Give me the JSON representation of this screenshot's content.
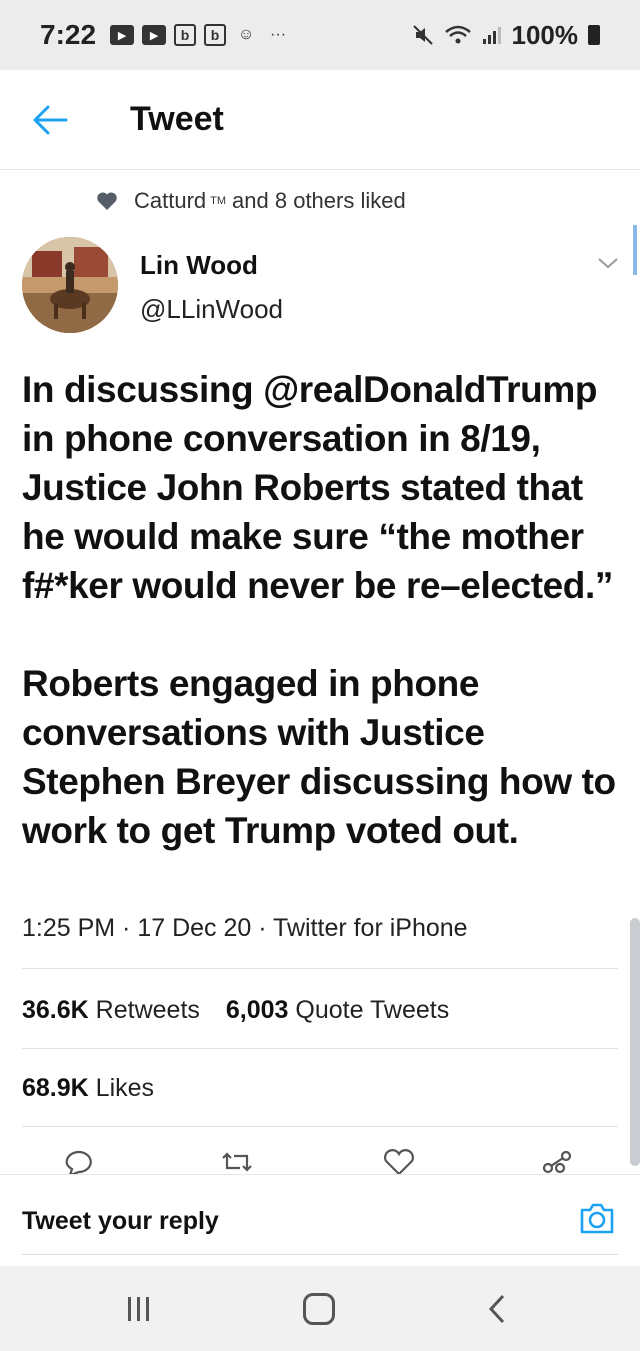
{
  "status_bar": {
    "time": "7:22",
    "icons": [
      "youtube-icon",
      "youtube-icon",
      "b-app-icon",
      "b-app-icon",
      "assistant-icon",
      "more-dots-icon"
    ],
    "icon_glyphs": [
      "▶",
      "▶",
      "b",
      "b",
      "☺",
      "···"
    ],
    "battery": "100%"
  },
  "header": {
    "title": "Tweet"
  },
  "social_context": {
    "name": "Catturd",
    "trademark": "TM",
    "suffix": "and 8 others liked"
  },
  "tweet": {
    "author_name": "Lin Wood",
    "author_handle": "@LLinWood",
    "paragraphs": [
      "In discussing @realDonaldTrump in phone conversation in 8/19, Justice John Roberts stated that he would make sure “the mother f#*ker would never be re–elected.”",
      "Roberts engaged in phone conversations with Justice Stephen Breyer discussing how to work to get Trump voted out."
    ],
    "meta": "1:25 PM · 17 Dec 20 · Twitter for iPhone",
    "stats": {
      "retweets_count": "36.6K",
      "retweets_label": "Retweets",
      "quotes_count": "6,003",
      "quotes_label": "Quote Tweets",
      "likes_count": "68.9K",
      "likes_label": "Likes"
    }
  },
  "reply": {
    "placeholder": "Tweet your reply"
  },
  "colors": {
    "accent": "#1da1f2",
    "text": "#111111",
    "divider": "#e1e1e1"
  }
}
